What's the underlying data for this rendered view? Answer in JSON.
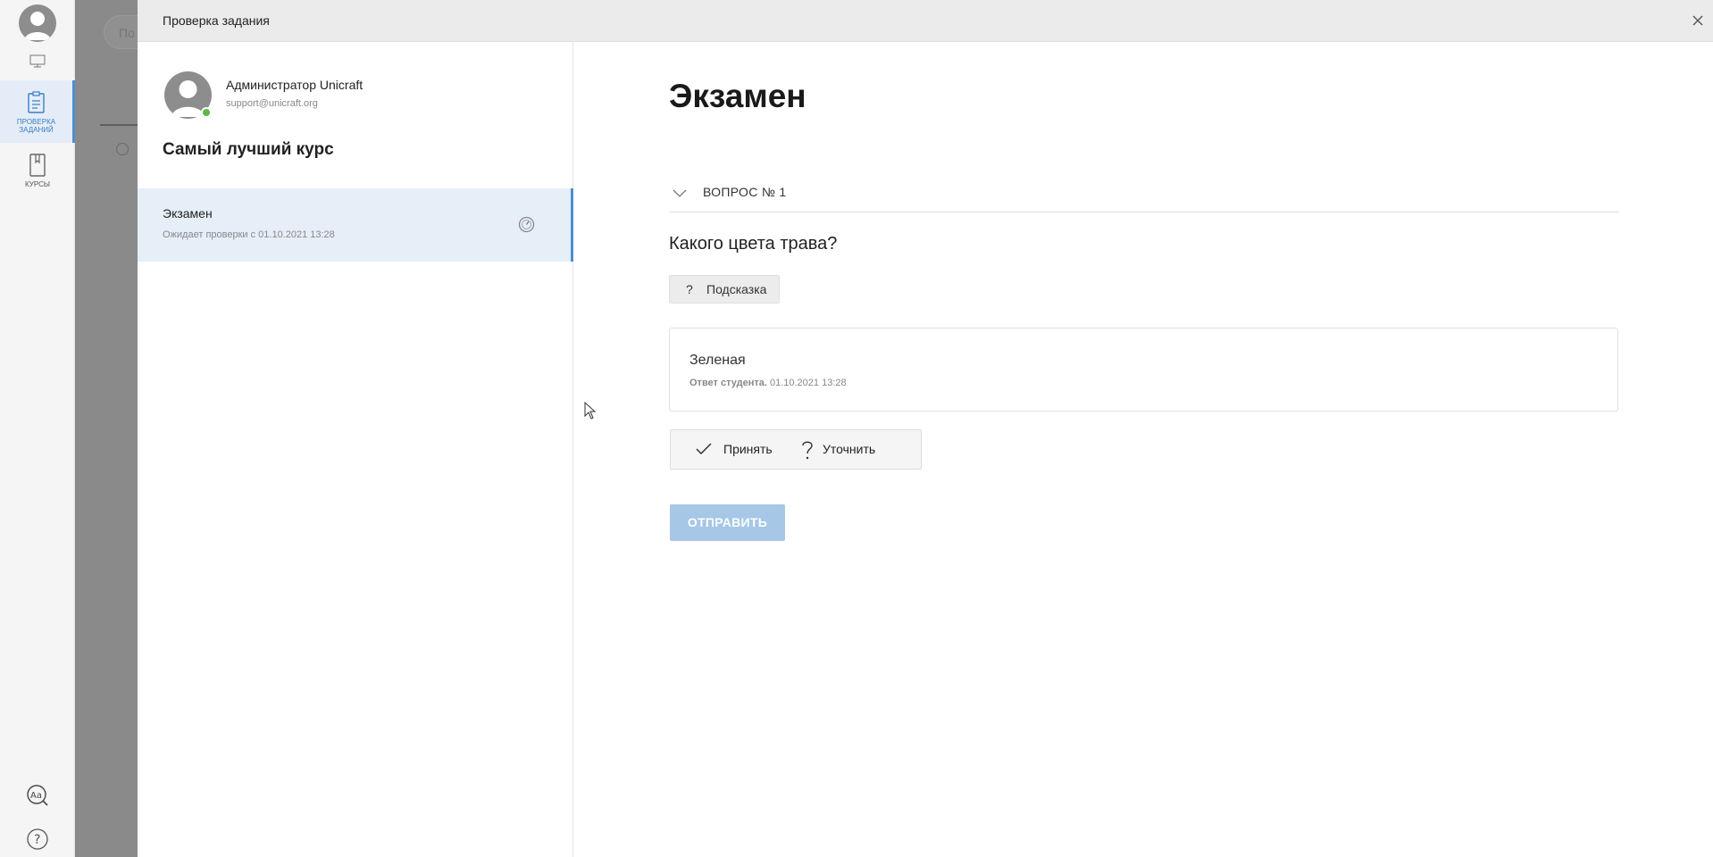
{
  "rail": {
    "items": [
      {
        "label": "ПРОВЕРКА\nЗАДАНИЙ",
        "icon": "task-review-icon",
        "active": true
      },
      {
        "label": "КУРСЫ",
        "icon": "book-icon",
        "active": false
      }
    ],
    "bottom_icons": [
      "font-settings-icon",
      "help-icon"
    ]
  },
  "background": {
    "search_placeholder": "По"
  },
  "modal": {
    "title": "Проверка задания",
    "user": {
      "name": "Администратор Unicraft",
      "email": "support@unicraft.org",
      "online": true
    },
    "course_title": "Самый лучший курс",
    "task": {
      "name": "Экзамен",
      "status": "Ожидает проверки с 01.10.2021 13:28"
    },
    "exam_title": "Экзамен",
    "question_label": "ВОПРОС № 1",
    "question_text": "Какого цвета трава?",
    "hint": {
      "symbol": "?",
      "label": "Подсказка"
    },
    "answer": {
      "text": "Зеленая",
      "meta_label": "Ответ студента.",
      "meta_time": "01.10.2021 13:28"
    },
    "actions": {
      "accept": "Принять",
      "clarify": "Уточнить"
    },
    "submit_label": "ОТПРАВИТЬ"
  },
  "colors": {
    "accent": "#4d8ed1",
    "selected_bg": "#e6eef7",
    "submit_disabled": "#a6c7e6",
    "online": "#5bb947"
  }
}
